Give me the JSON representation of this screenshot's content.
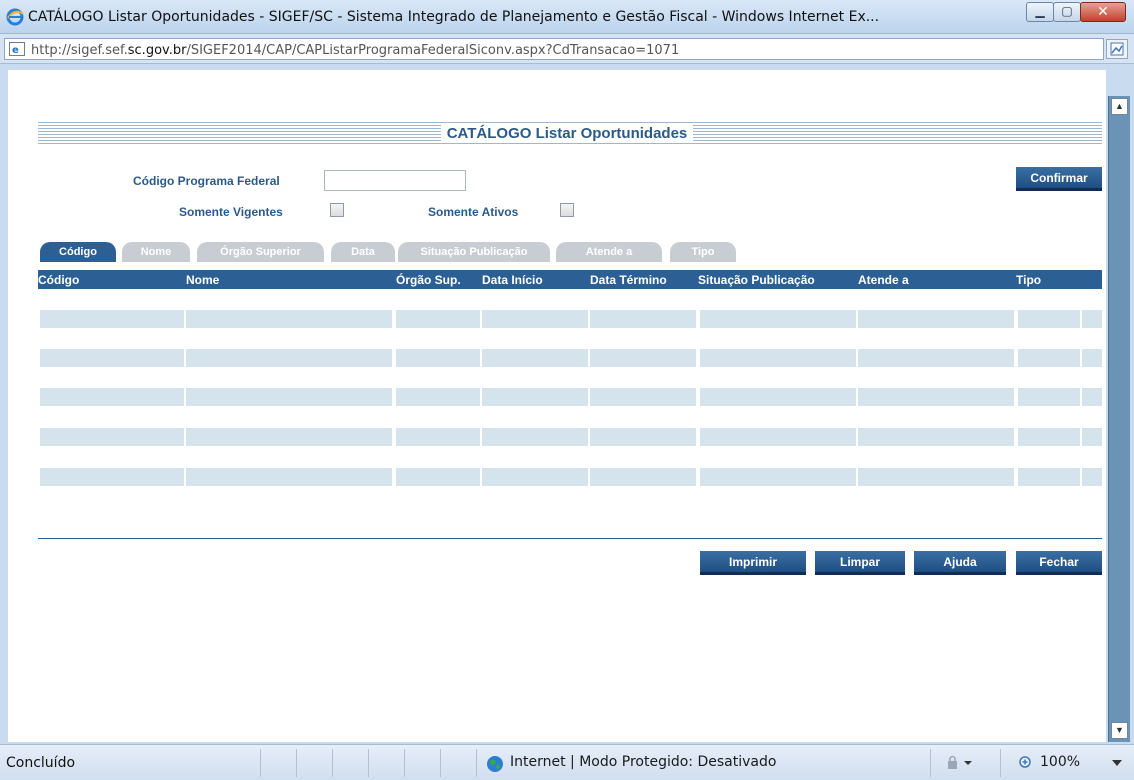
{
  "window": {
    "title": "CATÁLOGO Listar Oportunidades - SIGEF/SC - Sistema Integrado de Planejamento e Gestão Fiscal - Windows Internet Ex...",
    "url_prefix": "http://sigef.sef.",
    "url_domain": "sc.gov.br",
    "url_path": "/SIGEF2014/CAP/CAPListarProgramaFederalSiconv.aspx?CdTransacao=1071"
  },
  "page": {
    "heading": "CATÁLOGO Listar Oportunidades"
  },
  "form": {
    "codigo_label": "Código Programa Federal",
    "codigo_value": "",
    "vigentes_label": "Somente Vigentes",
    "ativos_label": "Somente Ativos",
    "confirm_label": "Confirmar"
  },
  "tabs": [
    {
      "label": "Código",
      "active": true
    },
    {
      "label": "Nome",
      "active": false
    },
    {
      "label": "Órgão Superior",
      "active": false
    },
    {
      "label": "Data",
      "active": false
    },
    {
      "label": "Situação Publicação",
      "active": false
    },
    {
      "label": "Atende a",
      "active": false
    },
    {
      "label": "Tipo",
      "active": false
    }
  ],
  "table": {
    "columns": [
      "Código",
      "Nome",
      "Órgão Sup.",
      "Data Início",
      "Data Término",
      "Situação Publicação",
      "Atende a",
      "Tipo"
    ],
    "rows": [
      [],
      [],
      [],
      [],
      []
    ]
  },
  "actions": {
    "print": "Imprimir",
    "clear": "Limpar",
    "help": "Ajuda",
    "close": "Fechar"
  },
  "status": {
    "text": "Concluído",
    "zone": "Internet | Modo Protegido: Desativado",
    "zoom": "100%"
  },
  "colors": {
    "accent": "#2c5f93",
    "label": "#2b5a8a",
    "row_fill": "#d5e3ec",
    "tab_inactive": "#c8cdd3"
  }
}
